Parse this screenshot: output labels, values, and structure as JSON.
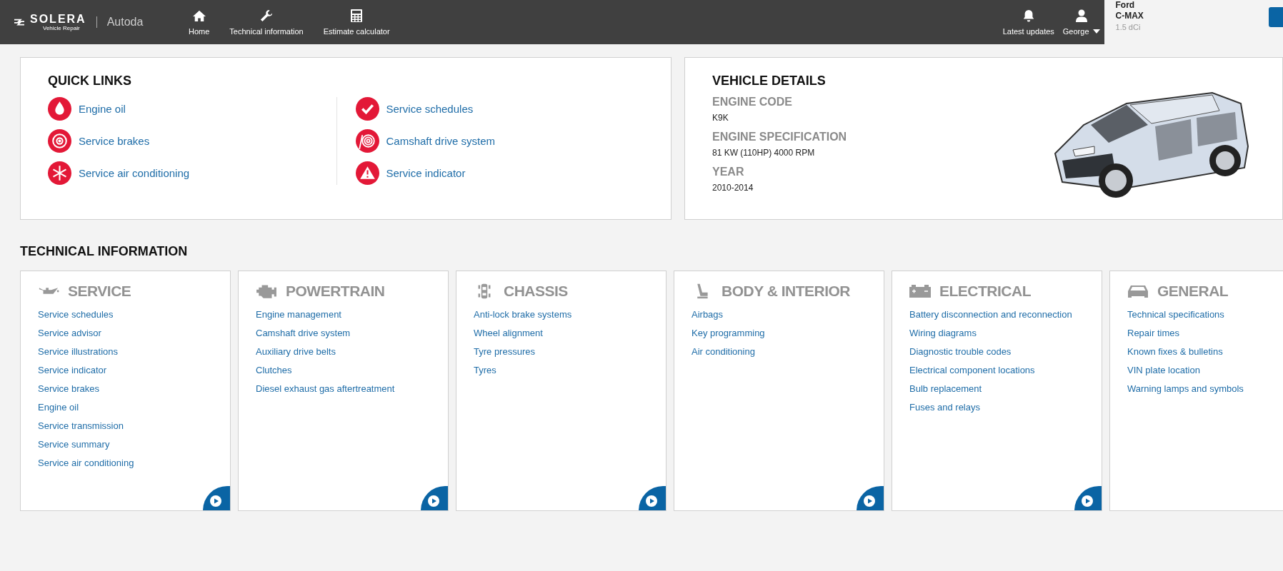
{
  "topbar": {
    "logo": {
      "brand": "SOLERA",
      "tagline": "Vehicle Repair",
      "product": "Autoda"
    },
    "nav": [
      {
        "kind": "home",
        "label": "Home"
      },
      {
        "kind": "wrench",
        "label": "Technical information"
      },
      {
        "kind": "calculator",
        "label": "Estimate calculator"
      }
    ],
    "updates": {
      "label": "Latest updates"
    },
    "user": {
      "label": "George"
    },
    "vehicle": {
      "make": "Ford",
      "model": "C-MAX",
      "engine": "1.5 dCi"
    }
  },
  "quick_links": {
    "title": "QUICK LINKS",
    "columns": [
      [
        {
          "kind": "drop",
          "label": "Engine oil"
        },
        {
          "kind": "brake",
          "label": "Service brakes"
        },
        {
          "kind": "snow",
          "label": "Service air conditioning"
        }
      ],
      [
        {
          "kind": "check",
          "label": "Service schedules"
        },
        {
          "kind": "belt",
          "label": "Camshaft drive system"
        },
        {
          "kind": "warning",
          "label": "Service indicator"
        }
      ]
    ]
  },
  "vehicle_details": {
    "title": "VEHICLE DETAILS",
    "fields": [
      {
        "label": "ENGINE CODE",
        "value": "K9K"
      },
      {
        "label": "ENGINE SPECIFICATION",
        "value": "81 KW (110HP) 4000 RPM"
      },
      {
        "label": "YEAR",
        "value": "2010-2014"
      }
    ]
  },
  "technical_information": {
    "title": "TECHNICAL INFORMATION",
    "categories": [
      {
        "kind": "oilcan",
        "title": "SERVICE",
        "play_button": true,
        "links": [
          "Service schedules",
          "Service advisor",
          "Service illustrations",
          "Service indicator",
          "Service brakes",
          "Engine oil",
          "Service transmission",
          "Service summary",
          "Service air conditioning"
        ]
      },
      {
        "kind": "engine",
        "title": "POWERTRAIN",
        "play_button": true,
        "links": [
          "Engine management",
          "Camshaft drive system",
          "Auxiliary drive belts",
          "Clutches",
          "Diesel exhaust gas aftertreatment"
        ]
      },
      {
        "kind": "chassis",
        "title": "CHASSIS",
        "play_button": true,
        "links": [
          "Anti-lock brake systems",
          "Wheel alignment",
          "Tyre pressures",
          "Tyres"
        ]
      },
      {
        "kind": "seat",
        "title": "BODY & INTERIOR",
        "play_button": true,
        "links": [
          "Airbags",
          "Key programming",
          "Air conditioning"
        ]
      },
      {
        "kind": "battery",
        "title": "ELECTRICAL",
        "play_button": true,
        "links": [
          "Battery disconnection and reconnection",
          "Wiring diagrams",
          "Diagnostic trouble codes",
          "Electrical component locations",
          "Bulb replacement",
          "Fuses and relays"
        ]
      },
      {
        "kind": "car",
        "title": "GENERAL",
        "play_button": false,
        "links": [
          "Technical specifications",
          "Repair times",
          "Known fixes & bulletins",
          "VIN plate location",
          "Warning lamps and symbols"
        ]
      }
    ]
  }
}
